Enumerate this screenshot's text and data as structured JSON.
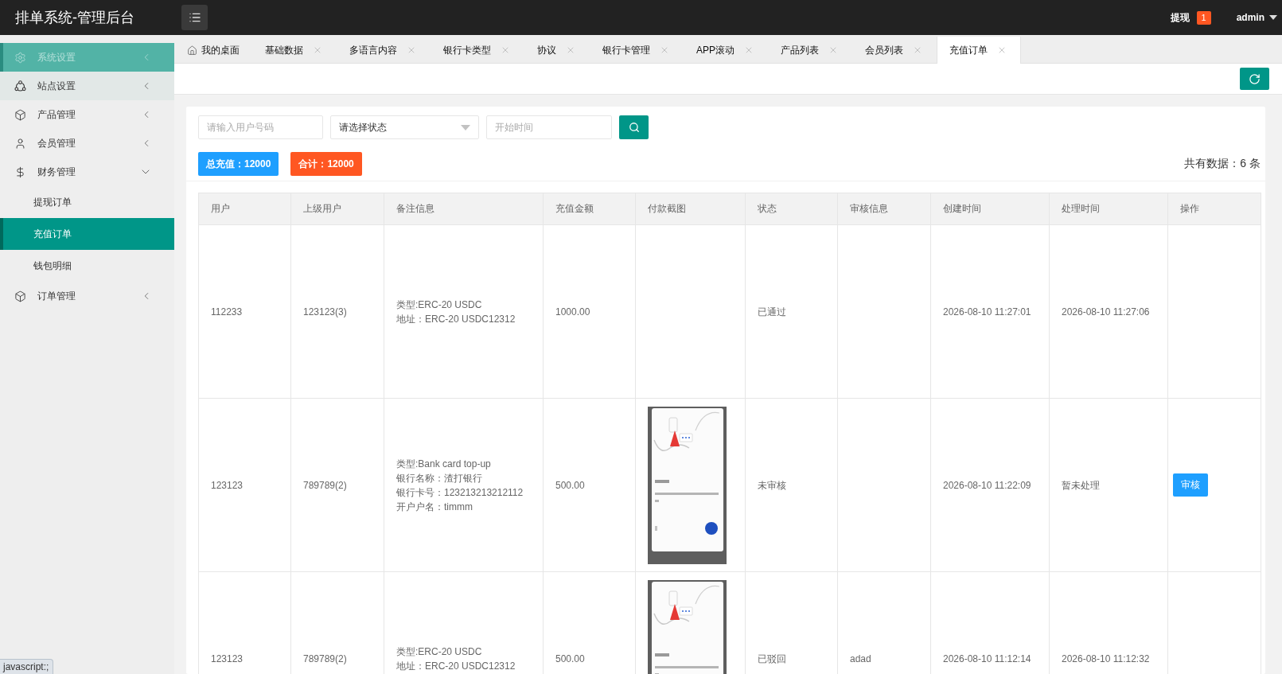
{
  "header": {
    "title": "排单系统-管理后台",
    "withdraw": {
      "label": "提现",
      "count": "1"
    },
    "user": "admin"
  },
  "sidebar": {
    "items": [
      {
        "label": "系统设置",
        "selected": true,
        "hovered": false,
        "expanded": false
      },
      {
        "label": "站点设置",
        "selected": false,
        "hovered": true,
        "expanded": false
      },
      {
        "label": "产品管理",
        "selected": false,
        "hovered": false,
        "expanded": false
      },
      {
        "label": "会员管理",
        "selected": false,
        "hovered": false,
        "expanded": false
      },
      {
        "label": "财务管理",
        "selected": false,
        "hovered": false,
        "expanded": true,
        "children": [
          {
            "label": "提现订单",
            "selected": false
          },
          {
            "label": "充值订单",
            "selected": true
          },
          {
            "label": "钱包明细",
            "selected": false
          }
        ]
      },
      {
        "label": "订单管理",
        "selected": false,
        "hovered": false,
        "expanded": false
      }
    ]
  },
  "tabs": [
    {
      "kind": "home",
      "label": "我的桌面",
      "selected": false
    },
    {
      "kind": "page",
      "label": "基础数据",
      "selected": false
    },
    {
      "kind": "page",
      "label": "多语言内容",
      "selected": false
    },
    {
      "kind": "page",
      "label": "银行卡类型",
      "selected": false
    },
    {
      "kind": "page",
      "label": "协议",
      "selected": false
    },
    {
      "kind": "page",
      "label": "银行卡管理",
      "selected": false
    },
    {
      "kind": "page",
      "label": "APP滚动",
      "selected": false
    },
    {
      "kind": "page",
      "label": "产品列表",
      "selected": false
    },
    {
      "kind": "page",
      "label": "会员列表",
      "selected": false
    },
    {
      "kind": "page",
      "label": "充值订单",
      "selected": true
    }
  ],
  "filters": {
    "user_field": {
      "placeholder": "请输入用户号码"
    },
    "status_select": {
      "value": "请选择状态"
    },
    "start_time_field": {
      "placeholder": "开始时间"
    }
  },
  "summary": {
    "badges": [
      {
        "label": "总充值：12000",
        "color": "#1e9fff"
      },
      {
        "label": "合计：12000",
        "color": "#ff5722"
      }
    ],
    "total": "共有数据：6 条"
  },
  "table": {
    "columns": [
      "用户",
      "上级用户",
      "备注信息",
      "充值金额",
      "付款截图",
      "状态",
      "审核信息",
      "创建时间",
      "处理时间",
      "操作"
    ],
    "rows": [
      {
        "user": "112233",
        "referrer": "123123(3)",
        "info": [
          "类型:ERC-20 USDC",
          "地址：ERC-20 USDC12312"
        ],
        "amount": "1000.00",
        "has_screenshot": false,
        "status": "已通过",
        "created": "2026-08-10 11:27:01",
        "processed": "2026-08-10 11:27:06"
      },
      {
        "user": "123123",
        "referrer": "789789(2)",
        "info": [
          "类型:Bank card top-up",
          "银行名称：渣打银行",
          "银行卡号：123213213212112",
          "开户户名：timmm"
        ],
        "amount": "500.00",
        "has_screenshot": true,
        "status": "未审核",
        "created": "2026-08-10 11:22:09",
        "processed": "暂未处理",
        "action": "审核"
      },
      {
        "user": "123123",
        "referrer": "789789(2)",
        "info": [
          "类型:ERC-20 USDC",
          "地址：ERC-20 USDC12312"
        ],
        "amount": "500.00",
        "has_screenshot": true,
        "status": "已驳回",
        "review_note": "adad",
        "created": "2026-08-10 11:12:14",
        "processed": "2026-08-10 11:12:32"
      }
    ]
  },
  "status_bar": {
    "url": "javascript:;"
  }
}
